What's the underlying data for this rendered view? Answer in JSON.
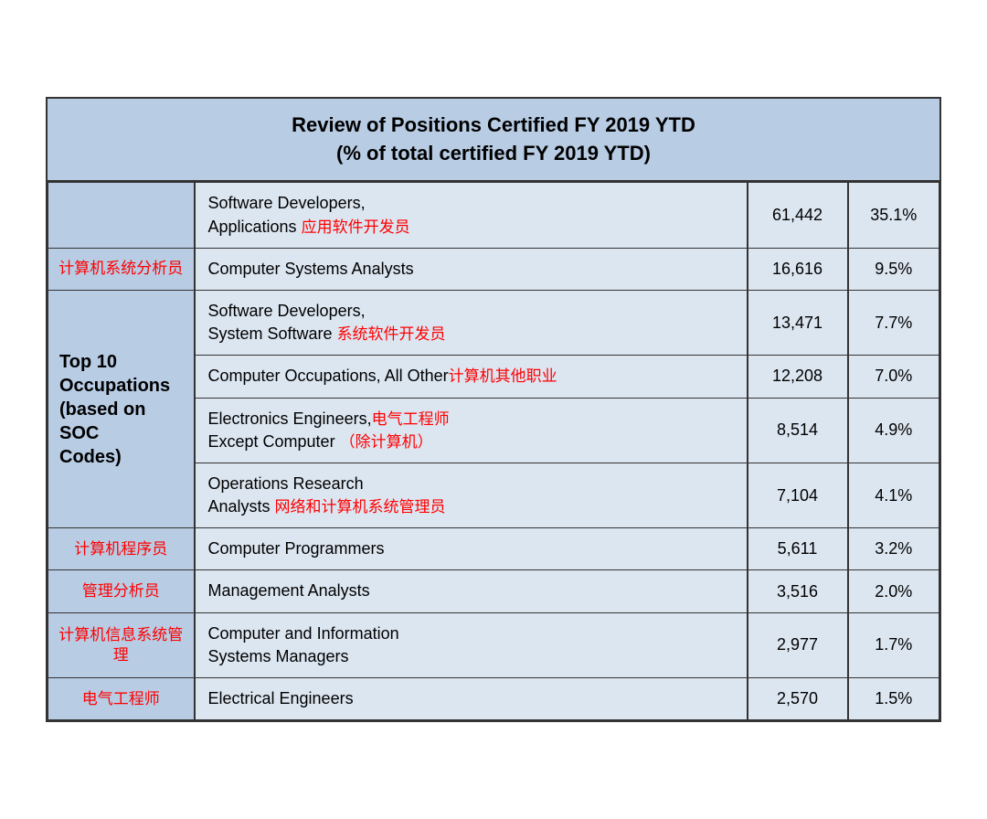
{
  "title": {
    "line1": "Review of Positions Certified FY 2019 YTD",
    "line2": "(% of total certified FY 2019 YTD)"
  },
  "label_top10": {
    "text": "Top 10\nOccupations\n(based on SOC\nCodes)"
  },
  "rows": [
    {
      "id": 1,
      "left_zh": "",
      "left_zh_visible": false,
      "occupation_en": "Software Developers, Applications",
      "occupation_zh": "应用软件开发员",
      "number": "61,442",
      "percent": "35.1%"
    },
    {
      "id": 2,
      "left_zh": "计算机系统分析员",
      "left_zh_visible": true,
      "occupation_en": "Computer Systems Analysts",
      "occupation_zh": "",
      "number": "16,616",
      "percent": "9.5%"
    },
    {
      "id": 3,
      "left_zh": "",
      "left_zh_visible": false,
      "occupation_en": "Software Developers, System Software",
      "occupation_zh": "系统软件开发员",
      "number": "13,471",
      "percent": "7.7%"
    },
    {
      "id": 4,
      "left_zh": "",
      "left_zh_visible": false,
      "occupation_en": "Computer Occupations, All Other",
      "occupation_zh": "计算机其他职业",
      "number": "12,208",
      "percent": "7.0%"
    },
    {
      "id": 5,
      "left_zh": "",
      "left_zh_visible": false,
      "occupation_en": "Electronics Engineers, Except Computer",
      "occupation_zh_line1": "电气工程师",
      "occupation_zh_line2": "（除计算机）",
      "number": "8,514",
      "percent": "4.9%"
    },
    {
      "id": 6,
      "left_zh": "",
      "left_zh_visible": false,
      "occupation_en": "Operations Research Analysts",
      "occupation_zh": "网络和计算机系统管理员",
      "number": "7,104",
      "percent": "4.1%"
    },
    {
      "id": 7,
      "left_zh": "计算机程序员",
      "left_zh_visible": true,
      "occupation_en": "Computer Programmers",
      "occupation_zh": "",
      "number": "5,611",
      "percent": "3.2%"
    },
    {
      "id": 8,
      "left_zh": "管理分析员",
      "left_zh_visible": true,
      "occupation_en": "Management Analysts",
      "occupation_zh": "",
      "number": "3,516",
      "percent": "2.0%"
    },
    {
      "id": 9,
      "left_zh": "计算机信息系统管理",
      "left_zh_visible": true,
      "occupation_en": "Computer and Information Systems Managers",
      "occupation_zh": "",
      "number": "2,977",
      "percent": "1.7%"
    },
    {
      "id": 10,
      "left_zh": "电气工程师",
      "left_zh_visible": true,
      "occupation_en": "Electrical Engineers",
      "occupation_zh": "",
      "number": "2,570",
      "percent": "1.5%"
    }
  ]
}
